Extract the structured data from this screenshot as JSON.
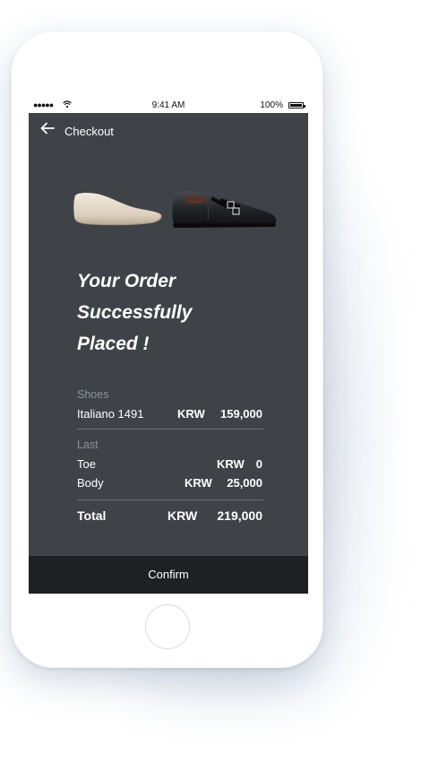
{
  "status_bar": {
    "time": "9:41 AM",
    "battery": "100%"
  },
  "nav": {
    "title": "Checkout"
  },
  "headline": {
    "line1": "Your Order",
    "line2": "Successfully",
    "line3": "Placed !"
  },
  "order": {
    "shoes": {
      "label": "Shoes",
      "items": [
        {
          "name": "Italiano 1491",
          "currency": "KRW",
          "amount": "159,000"
        }
      ]
    },
    "last": {
      "label": "Last",
      "items": [
        {
          "name": "Toe",
          "currency": "KRW",
          "amount": "0"
        },
        {
          "name": "Body",
          "currency": "KRW",
          "amount": "25,000"
        }
      ]
    },
    "total": {
      "label": "Total",
      "currency": "KRW",
      "amount": "219,000"
    }
  },
  "confirm_button": {
    "label": "Confirm"
  },
  "colors": {
    "screen_background": "#3f4348",
    "confirm_bar": "#1e2124",
    "section_label": "#8e949b"
  }
}
